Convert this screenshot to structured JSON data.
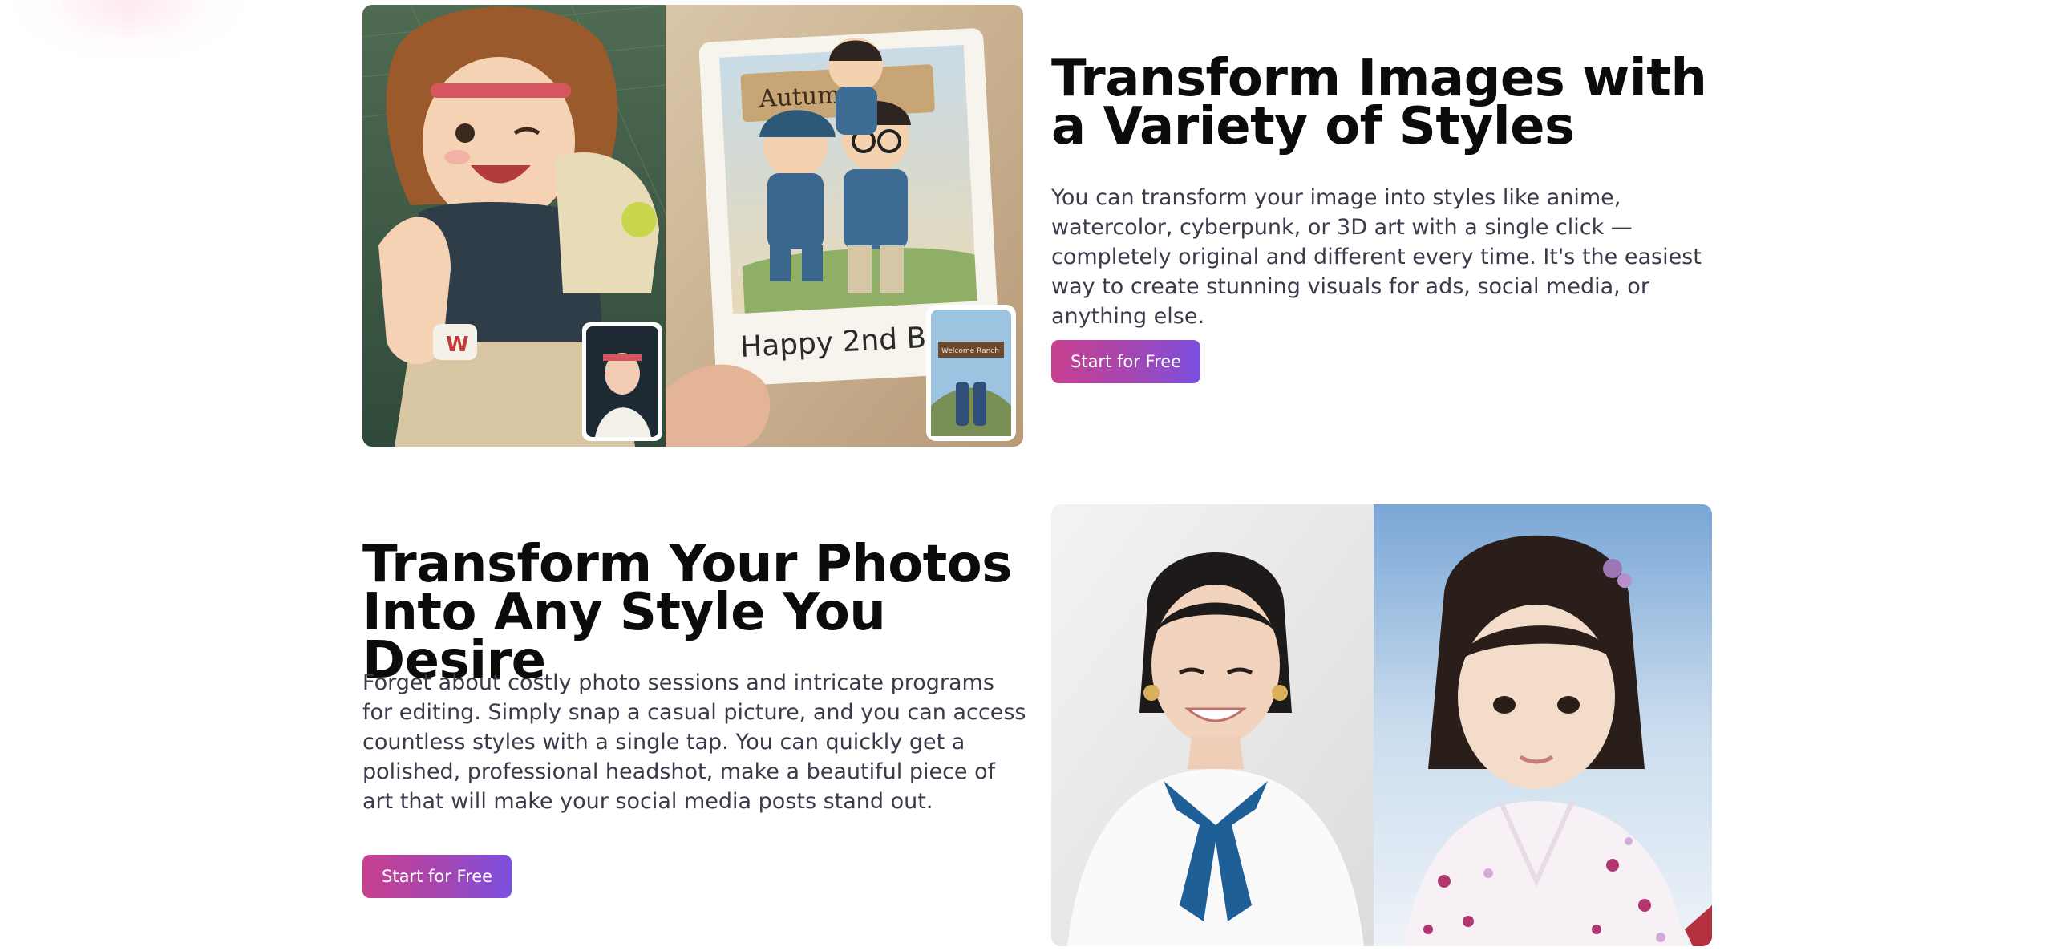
{
  "section_1": {
    "heading": "Transform Images with a Variety of Styles",
    "body": "You can transform your image into styles like anime, watercolor, cyberpunk, or 3D art with a single click — completely original and different every time. It's the easiest way to create stunning visuals for ads, social media, or anything else.",
    "cta_label": "Start for Free",
    "image": {
      "photo_sign_text": "Autumn",
      "card_caption": "Happy 2nd Birthd",
      "thumb_sign_text": "Welcome Ranch"
    }
  },
  "section_2": {
    "heading": "Transform Your Photos Into Any Style You Desire",
    "body": "Forget about costly photo sessions and intricate programs for editing. Simply snap a casual picture, and you can access countless styles with a single tap. You can quickly get a polished, professional headshot, make a beautiful piece of art that will make your social media posts stand out.",
    "cta_label": "Start for Free"
  },
  "colors": {
    "cta_gradient_start": "#c8408f",
    "cta_gradient_end": "#7b4fe0",
    "heading": "#0b0b0b",
    "body_text": "#3a3a4a"
  }
}
